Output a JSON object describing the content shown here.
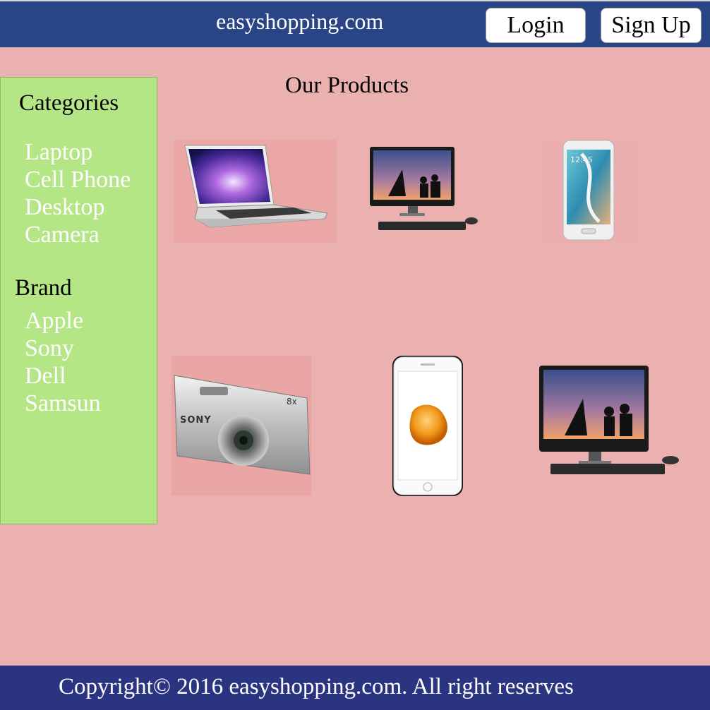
{
  "header": {
    "site_title": "easyshopping.com",
    "login_label": "Login",
    "signup_label": "Sign Up"
  },
  "sidebar": {
    "categories_heading": "Categories",
    "categories": [
      "Laptop",
      "Cell Phone",
      "Desktop",
      "Camera"
    ],
    "brand_heading": "Brand",
    "brands": [
      "Apple",
      "Sony",
      "Dell",
      "Samsun"
    ]
  },
  "main": {
    "title": "Our Products",
    "products": [
      {
        "icon": "laptop-image"
      },
      {
        "icon": "desktop-image"
      },
      {
        "icon": "galaxy-phone-image"
      },
      {
        "icon": "sony-camera-image",
        "brand_text": "SONY",
        "badge": "8x"
      },
      {
        "icon": "iphone-image"
      },
      {
        "icon": "desktop-image"
      }
    ]
  },
  "footer": {
    "copyright": "Copyright© 2016 easyshopping.com. All right reserves"
  }
}
